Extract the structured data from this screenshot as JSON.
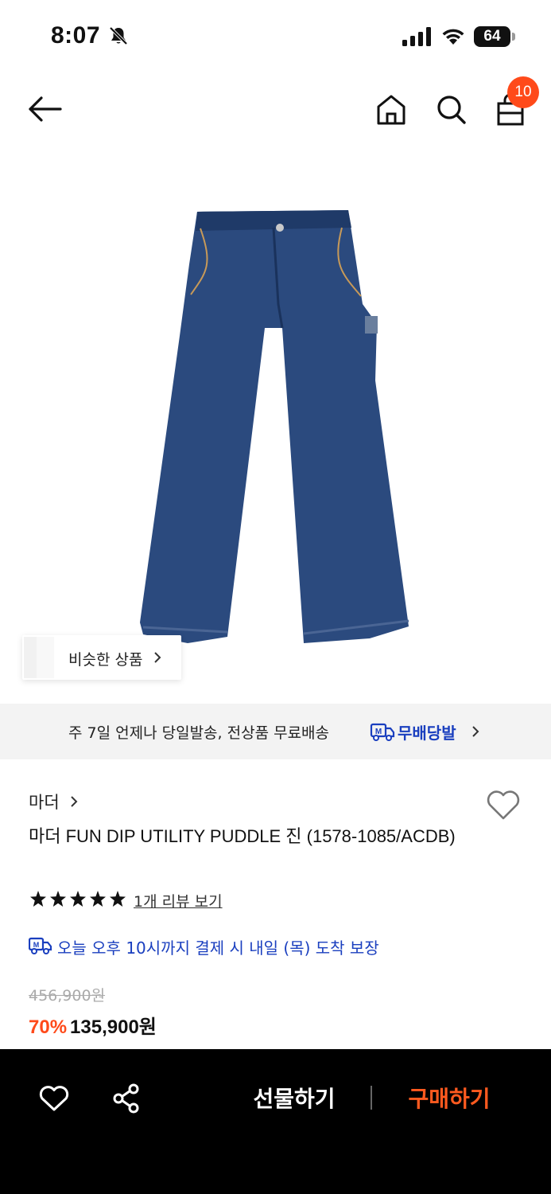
{
  "status_bar": {
    "time": "8:07",
    "battery": "64"
  },
  "header": {
    "cart_count": "10"
  },
  "similar": {
    "label": "비슷한 상품"
  },
  "delivery": {
    "text": "주 7일 언제나 당일발송, 전상품 무료배송",
    "badge_label": "무배당발",
    "badge_color": "#1a3fbf"
  },
  "product": {
    "brand": "마더",
    "title": "마더 FUN DIP UTILITY PUDDLE 진 (1578-1085/ACDB)",
    "rating_stars": 5,
    "review_link": "1개 리뷰 보기",
    "arrival_text": "오늘 오후 10시까지 결제 시 내일 (목) 도착 보장",
    "original_price": "456,900원",
    "discount": "70%",
    "sale_price": "135,900원"
  },
  "bottom_bar": {
    "gift_label": "선물하기",
    "buy_label": "구매하기"
  },
  "colors": {
    "accent": "#ff4a1a",
    "brand_blue": "#1a3fbf",
    "denim": "#2b4a7e"
  }
}
